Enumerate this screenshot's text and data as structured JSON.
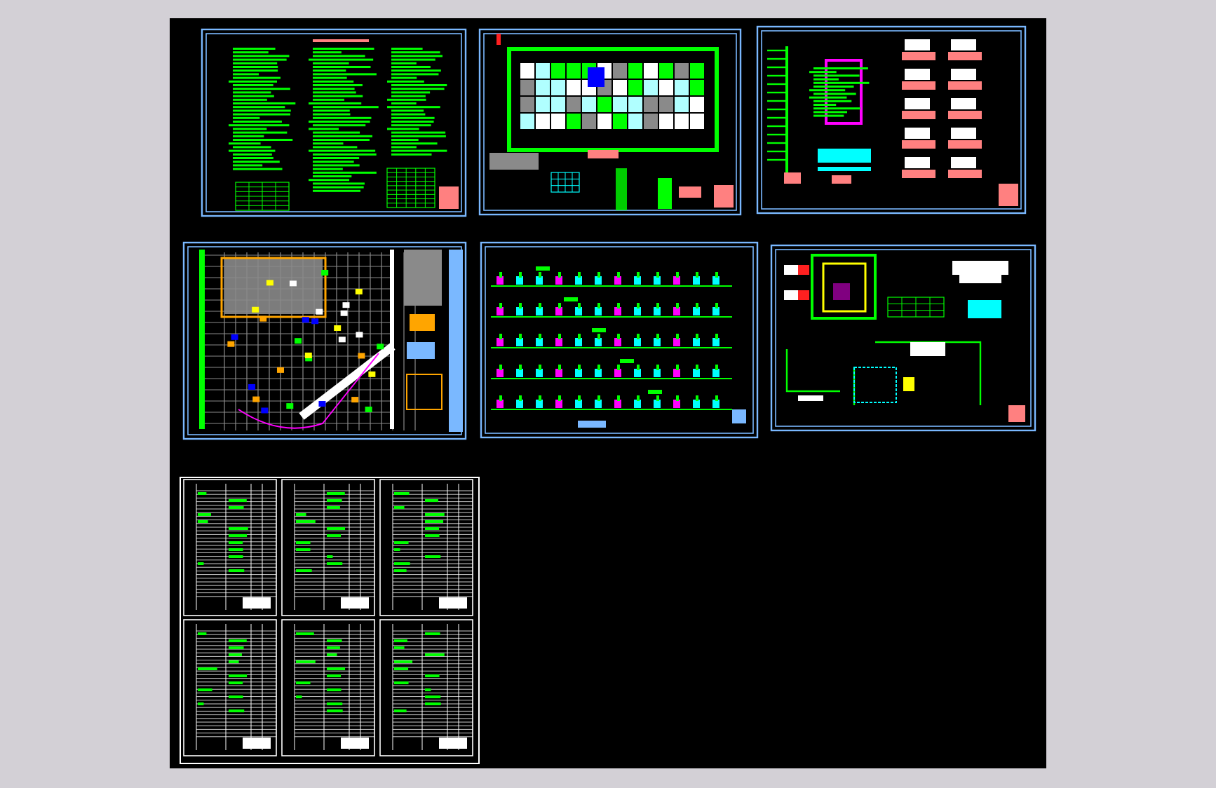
{
  "viewer": {
    "sheets": [
      {
        "kind": "notes"
      },
      {
        "kind": "plan"
      },
      {
        "kind": "riser"
      },
      {
        "kind": "site"
      },
      {
        "kind": "elevation"
      },
      {
        "kind": "system"
      },
      {
        "kind": "tables"
      }
    ]
  }
}
